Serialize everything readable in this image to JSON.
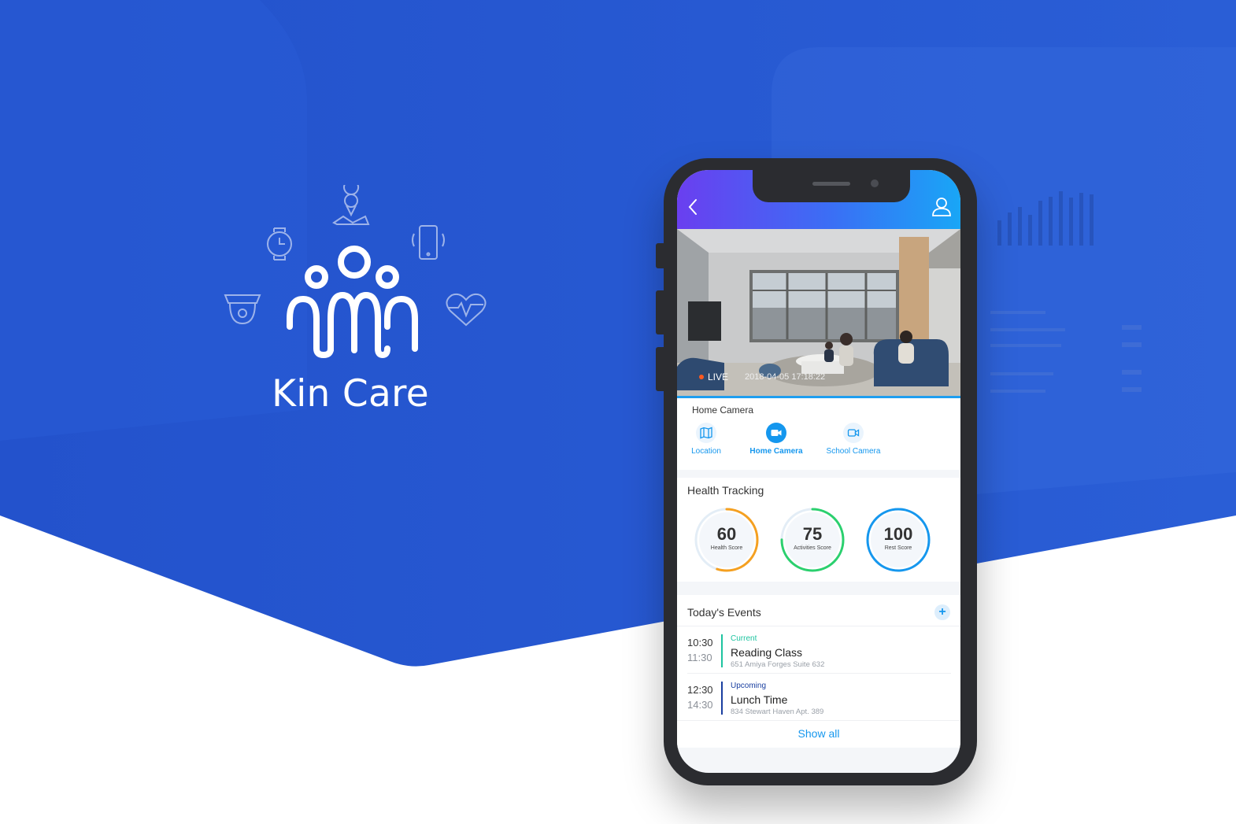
{
  "brand": {
    "name": "Kin Care"
  },
  "app": {
    "camera": {
      "live_label": "LIVE",
      "timestamp": "2018-04-05 17:18:22",
      "section_title": "Home Camera",
      "tabs": [
        {
          "label": "Location",
          "icon": "map-icon",
          "active": false
        },
        {
          "label": "Home Camera",
          "icon": "video-camera-icon",
          "active": true
        },
        {
          "label": "School Camera",
          "icon": "video-outline-icon",
          "active": false
        }
      ]
    },
    "health": {
      "title": "Health Tracking",
      "gauges": [
        {
          "value": "60",
          "label": "Health Score",
          "fraction": 0.55,
          "color": "#f5a020"
        },
        {
          "value": "75",
          "label": "Activities Score",
          "fraction": 0.75,
          "color": "#2bd06e"
        },
        {
          "value": "100",
          "label": "Rest Score",
          "fraction": 1.0,
          "color": "#1597ee"
        }
      ]
    },
    "events": {
      "title": "Today's Events",
      "items": [
        {
          "start": "10:30",
          "end": "11:30",
          "status": "Current",
          "status_color": "#1ec4a0",
          "name": "Reading Class",
          "address": "651 Amiya Forges Suite 632"
        },
        {
          "start": "12:30",
          "end": "14:30",
          "status": "Upcoming",
          "status_color": "#1a3fa0",
          "name": "Lunch Time",
          "address": "834 Stewart Haven Apt. 389"
        }
      ],
      "show_all": "Show  all"
    }
  },
  "background_dashboard": {
    "score": "60"
  },
  "colors": {
    "brand_blue": "#2556cf",
    "accent": "#1597ee"
  }
}
